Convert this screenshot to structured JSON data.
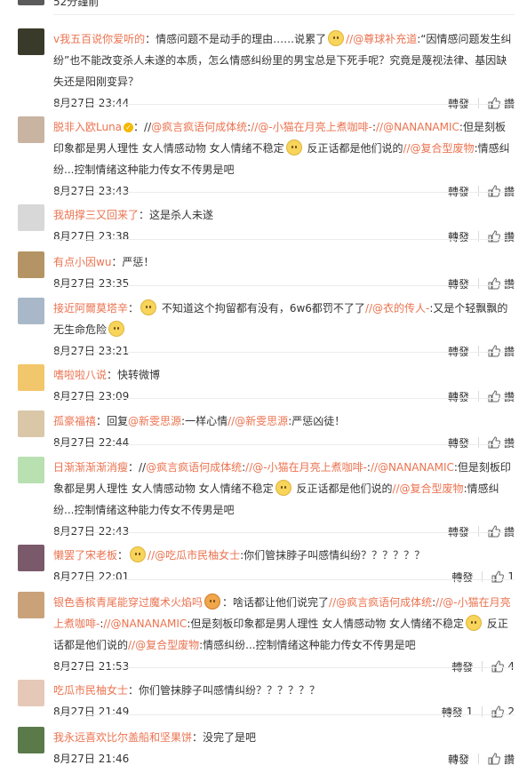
{
  "top_partial": {
    "time": "52分鐘前"
  },
  "labels": {
    "repost": "轉發",
    "like": "讚"
  },
  "comments": [
    {
      "user": "v我五百说你爱听的",
      "parts": [
        {
          "t": "text",
          "v": "：情感问题不是动手的理由……说累了"
        },
        {
          "t": "emoji",
          "v": "tired-emoji"
        },
        {
          "t": "link",
          "v": "//@尊球补充道"
        },
        {
          "t": "text",
          "v": ":“因情感问题发生纠纷”也不能改变杀人未遂的本质，怎么情感纠纷里的男宝总是下死手呢？究竟是蔑视法律、基因缺失还是阳刚变异？"
        }
      ],
      "time": "8月27日 23:44",
      "repost_count": "",
      "like_count": "",
      "avatar": "#3a3a2a"
    },
    {
      "user": "脱非入欧Luna",
      "verified": true,
      "parts": [
        {
          "t": "text",
          "v": "：//"
        },
        {
          "t": "link",
          "v": "@疯言疯语何成体统"
        },
        {
          "t": "text",
          "v": ":"
        },
        {
          "t": "link",
          "v": "//@-小猫在月亮上煮咖啡-"
        },
        {
          "t": "text",
          "v": ":"
        },
        {
          "t": "link",
          "v": "//@NANANAMIC"
        },
        {
          "t": "text",
          "v": ":但是刻板印象都是男人理性 女人情感动物 女人情绪不稳定"
        },
        {
          "t": "emoji",
          "v": "crying-emoji"
        },
        {
          "t": "text",
          "v": " 反正话都是他们说的"
        },
        {
          "t": "link",
          "v": "//@复合型废物"
        },
        {
          "t": "text",
          "v": ":情感纠纷...控制情绪这种能力传女不传男是吧"
        }
      ],
      "time": "8月27日 23:43",
      "repost_count": "",
      "like_count": "",
      "avatar": "#c8b4a0"
    },
    {
      "user": "我胡撑三又回来了",
      "parts": [
        {
          "t": "text",
          "v": "：这是杀人未遂"
        }
      ],
      "time": "8月27日 23:38",
      "repost_count": "",
      "like_count": "",
      "avatar": "#d8d8d8"
    },
    {
      "user": "有点小因wu",
      "parts": [
        {
          "t": "text",
          "v": "：严惩！"
        }
      ],
      "time": "8月27日 23:35",
      "repost_count": "",
      "like_count": "",
      "avatar": "#b49464"
    },
    {
      "user": "接近阿爾莫塔辛",
      "parts": [
        {
          "t": "text",
          "v": "："
        },
        {
          "t": "emoji",
          "v": "smile-emoji"
        },
        {
          "t": "text",
          "v": " 不知道这个拘留都有没有，6w6都罚不了了"
        },
        {
          "t": "link",
          "v": "//@衣的传人-"
        },
        {
          "t": "text",
          "v": ":又是个轻飘飘的无生命危险"
        },
        {
          "t": "emoji",
          "v": "tired-emoji"
        }
      ],
      "time": "8月27日 23:21",
      "repost_count": "",
      "like_count": "",
      "avatar": "#a8b8c8"
    },
    {
      "user": "嗜啦啦八说",
      "parts": [
        {
          "t": "text",
          "v": "：快转微博"
        }
      ],
      "time": "8月27日 23:09",
      "repost_count": "",
      "like_count": "",
      "avatar": "#f2c66a"
    },
    {
      "user": "孤豪福禧",
      "parts": [
        {
          "t": "text",
          "v": "：回复"
        },
        {
          "t": "link",
          "v": "@新雯思源"
        },
        {
          "t": "text",
          "v": ":一样心情"
        },
        {
          "t": "link",
          "v": "//@新雯思源"
        },
        {
          "t": "text",
          "v": ":严惩凶徒！"
        }
      ],
      "time": "8月27日 22:44",
      "repost_count": "",
      "like_count": "",
      "avatar": "#d9c7a8"
    },
    {
      "user": "日渐渐渐渐消瘦",
      "parts": [
        {
          "t": "text",
          "v": "：//"
        },
        {
          "t": "link",
          "v": "@疯言疯语何成体统"
        },
        {
          "t": "text",
          "v": ":"
        },
        {
          "t": "link",
          "v": "//@-小猫在月亮上煮咖啡-"
        },
        {
          "t": "text",
          "v": ":"
        },
        {
          "t": "link",
          "v": "//@NANANAMIC"
        },
        {
          "t": "text",
          "v": ":但是刻板印象都是男人理性 女人情感动物 女人情绪不稳定"
        },
        {
          "t": "emoji",
          "v": "crying-emoji"
        },
        {
          "t": "text",
          "v": " 反正话都是他们说的"
        },
        {
          "t": "link",
          "v": "//@复合型废物"
        },
        {
          "t": "text",
          "v": ":情感纠纷...控制情绪这种能力传女不传男是吧"
        }
      ],
      "time": "8月27日 22:43",
      "repost_count": "",
      "like_count": "",
      "avatar": "#b8e0b0"
    },
    {
      "user": "懒罢了宋老板",
      "parts": [
        {
          "t": "text",
          "v": "："
        },
        {
          "t": "emoji",
          "v": "crying-emoji"
        },
        {
          "t": "link",
          "v": "//@吃瓜市民柚女士"
        },
        {
          "t": "text",
          "v": ":你们管抹脖子叫感情纠纷？？？？？？"
        }
      ],
      "time": "8月27日 22:01",
      "repost_count": "",
      "like_count": "1",
      "avatar": "#7a5a6a"
    },
    {
      "user": "银色香槟青尾能穿过魔术火焰吗",
      "parts": [
        {
          "t": "emoji",
          "v": "crying-red-emoji"
        },
        {
          "t": "text",
          "v": "：啥话都让他们说完了"
        },
        {
          "t": "link",
          "v": "//@疯言疯语何成体统"
        },
        {
          "t": "text",
          "v": ":"
        },
        {
          "t": "link",
          "v": "//@-小猫在月亮上煮咖啡-"
        },
        {
          "t": "text",
          "v": ":"
        },
        {
          "t": "link",
          "v": "//@NANANAMIC"
        },
        {
          "t": "text",
          "v": ":但是刻板印象都是男人理性 女人情感动物 女人情绪不稳定"
        },
        {
          "t": "emoji",
          "v": "crying-emoji"
        },
        {
          "t": "text",
          "v": " 反正话都是他们说的"
        },
        {
          "t": "link",
          "v": "//@复合型废物"
        },
        {
          "t": "text",
          "v": ":情感纠纷...控制情绪这种能力传女不传男是吧"
        }
      ],
      "time": "8月27日 21:53",
      "repost_count": "",
      "like_count": "4",
      "avatar": "#c9a27a"
    },
    {
      "user": "吃瓜市民柚女士",
      "parts": [
        {
          "t": "text",
          "v": "：你们管抹脖子叫感情纠纷？？？？？？"
        }
      ],
      "time": "8月27日 21:49",
      "repost_count": "1",
      "like_count": "2",
      "avatar": "#e6c8b8"
    },
    {
      "user": "我永远喜欢比尔盖船和坚果饼",
      "parts": [
        {
          "t": "text",
          "v": "：没完了是吧"
        }
      ],
      "time": "8月27日 21:46",
      "repost_count": "",
      "like_count": "",
      "avatar": "#5a7a4a"
    }
  ]
}
